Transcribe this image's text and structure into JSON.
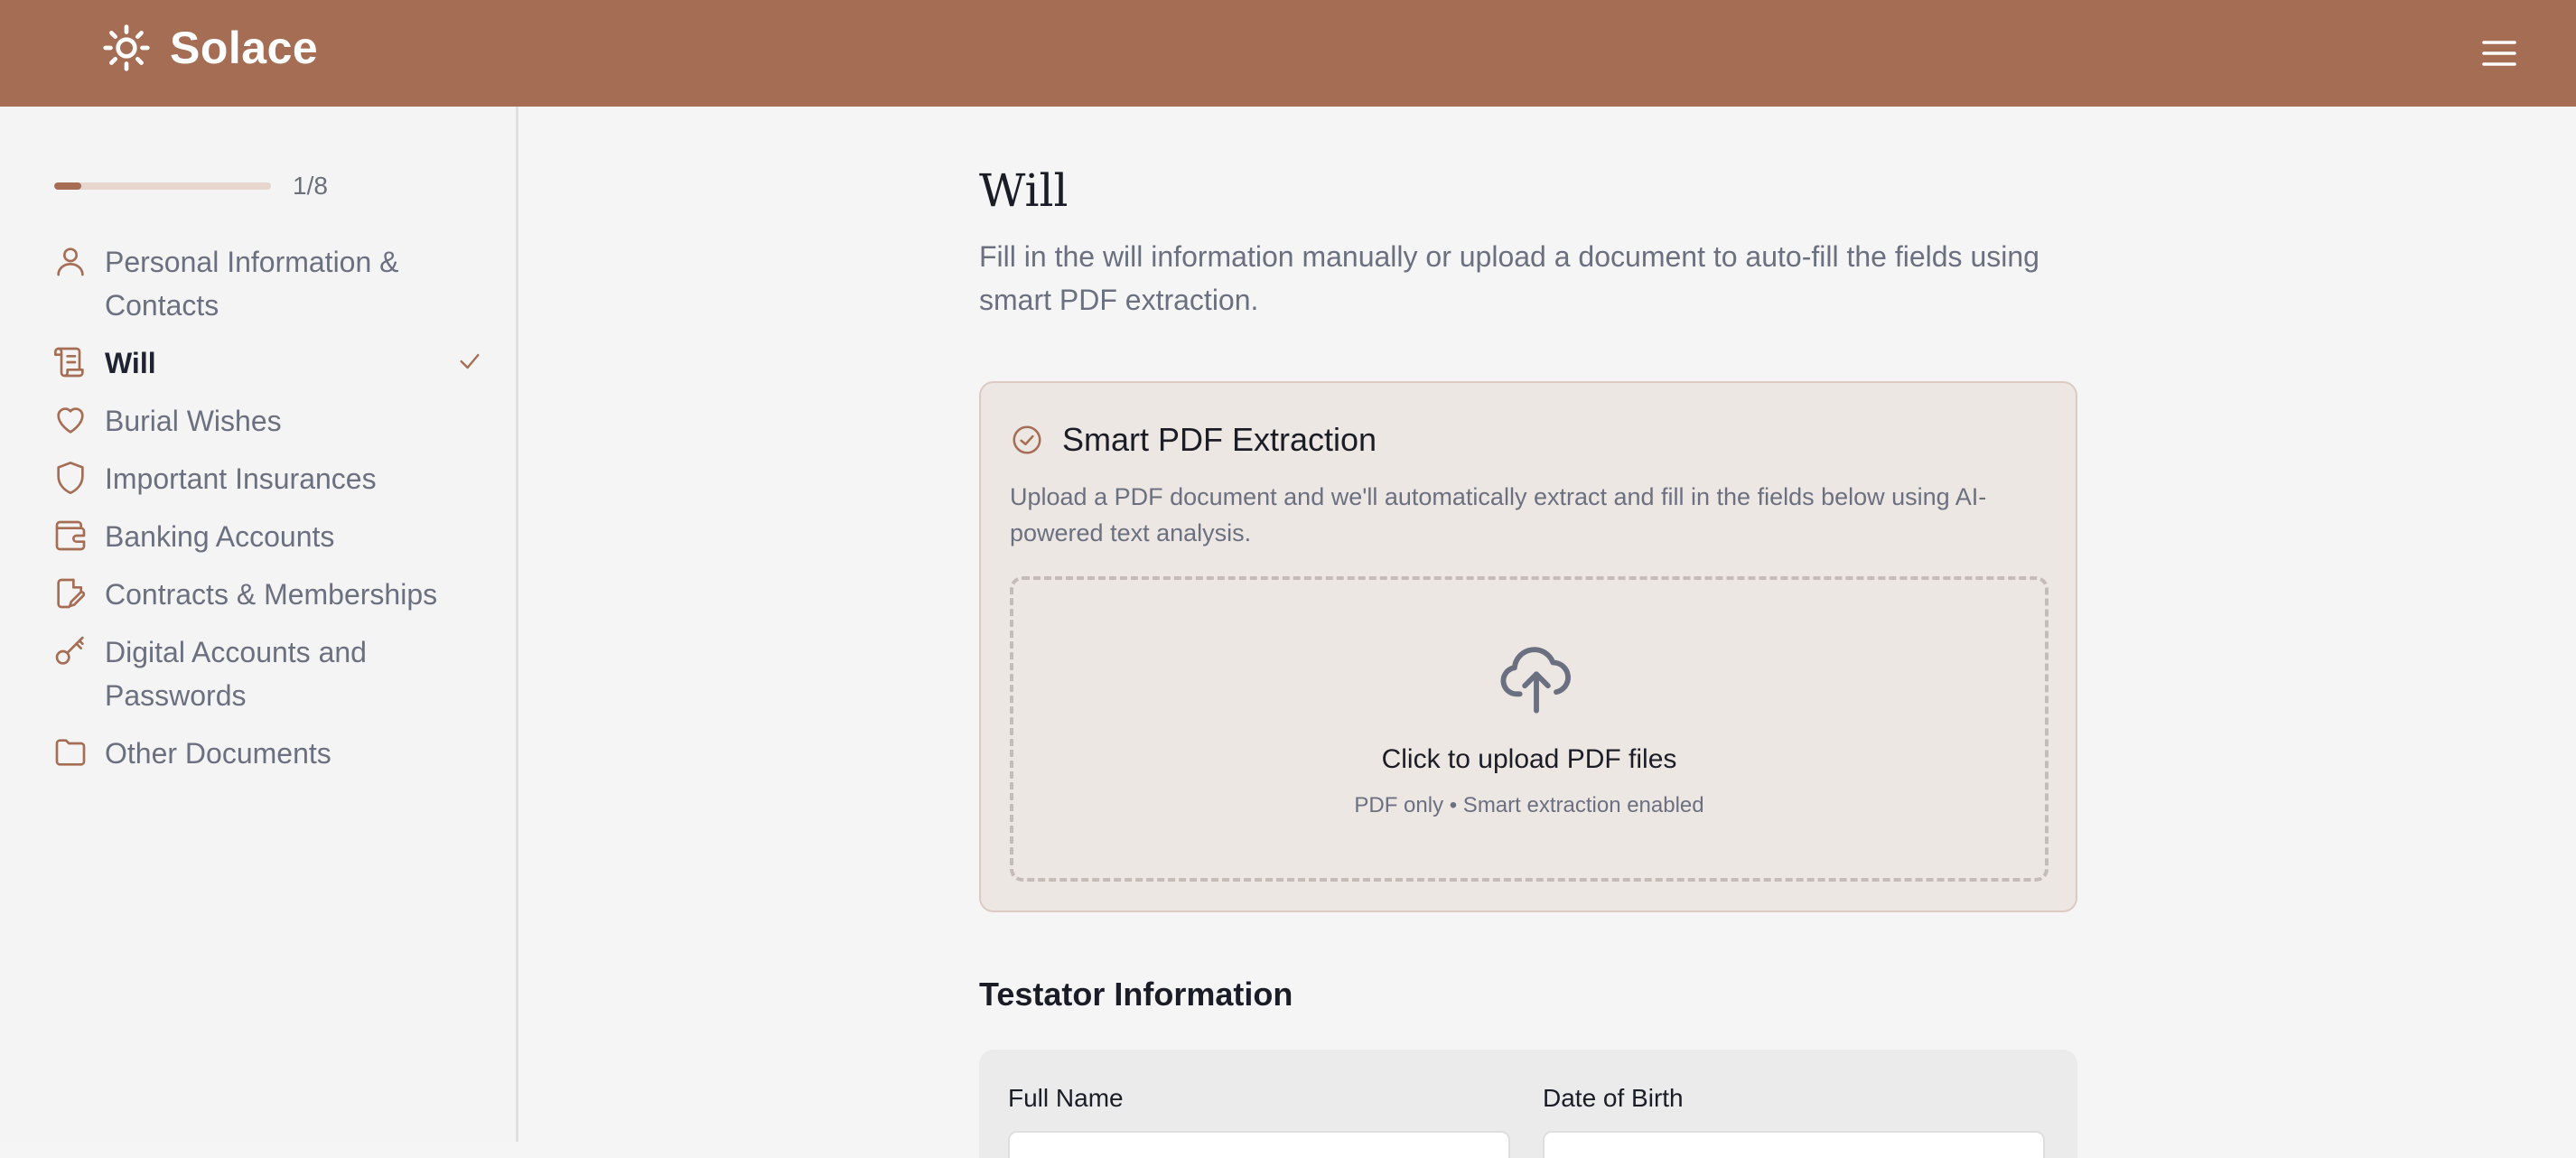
{
  "app": {
    "name": "Solace",
    "brand_icon": "sun-icon",
    "menu_icon": "hamburger-menu-icon",
    "accent_color": "#a56d54"
  },
  "progress": {
    "text": "1/8",
    "fraction": 0.125
  },
  "sidebar": {
    "items": [
      {
        "label": "Personal Information & Contacts",
        "icon": "user-icon"
      },
      {
        "label": "Will",
        "icon": "scroll-icon",
        "active": true,
        "completed": true
      },
      {
        "label": "Burial Wishes",
        "icon": "heart-icon"
      },
      {
        "label": "Important Insurances",
        "icon": "shield-icon"
      },
      {
        "label": "Banking Accounts",
        "icon": "wallet-icon"
      },
      {
        "label": "Contracts & Memberships",
        "icon": "document-edit-icon"
      },
      {
        "label": "Digital Accounts and Passwords",
        "icon": "key-icon"
      },
      {
        "label": "Other Documents",
        "icon": "folder-icon"
      }
    ]
  },
  "main": {
    "title": "Will",
    "description": "Fill in the will information manually or upload a document to auto-fill the fields using smart PDF extraction.",
    "extraction": {
      "icon": "check-circle-icon",
      "title": "Smart PDF Extraction",
      "description": "Upload a PDF document and we'll automatically extract and fill in the fields below using AI-powered text analysis.",
      "upload_icon": "cloud-upload-icon",
      "upload_label": "Click to upload PDF files",
      "upload_hint": "PDF only • Smart extraction enabled"
    },
    "section_title": "Testator Information",
    "fields": {
      "full_name_label": "Full Name",
      "date_of_birth_label": "Date of Birth"
    }
  }
}
